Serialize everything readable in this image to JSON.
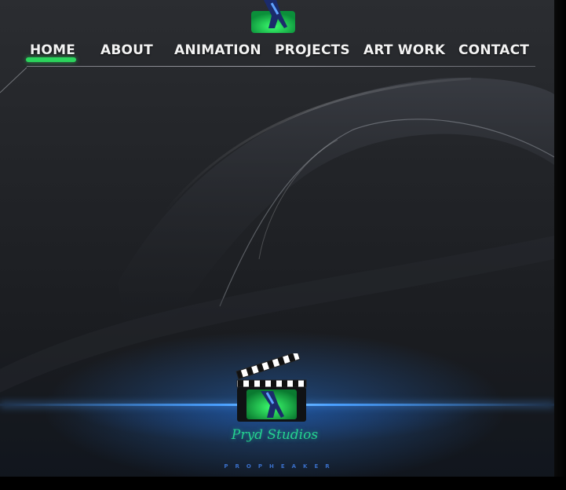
{
  "nav": {
    "items": [
      {
        "label": "HOME",
        "active": true
      },
      {
        "label": "ABOUT",
        "active": false
      },
      {
        "label": "ANIMATION",
        "active": false
      },
      {
        "label": "PROJECTS",
        "active": false
      },
      {
        "label": "ART WORK",
        "active": false
      },
      {
        "label": "CONTACT",
        "active": false
      }
    ]
  },
  "footer_logo": {
    "name": "Pryd Studios",
    "tagline": "PROPHEAKER"
  },
  "colors": {
    "background": "#222428",
    "nav_text": "#f2f2f2",
    "active_underline": "#2bd45c",
    "studio_name": "#25d28f",
    "stage_glow": "#4aa0ff"
  },
  "icons": {
    "top_logo": "figure-logo-icon",
    "clapper": "clapperboard-icon"
  }
}
